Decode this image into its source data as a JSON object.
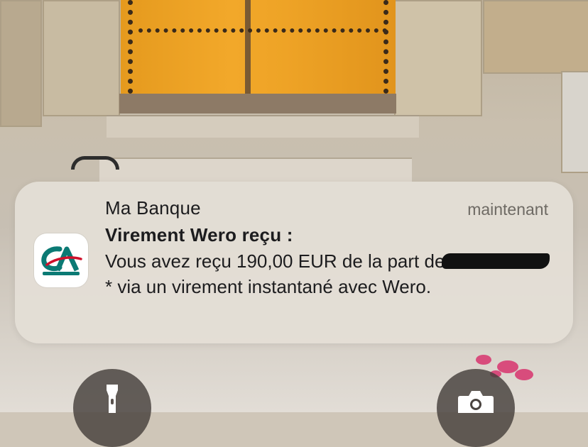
{
  "notification": {
    "app_name": "Ma Banque",
    "time": "maintenant",
    "title": "Virement Wero reçu :",
    "body_part1": "Vous avez reçu 190,00 EUR de la part de",
    "body_redacted_tail": "*",
    "body_part2": " via un virement instantané avec Wero.",
    "app_icon": "credit-agricole-logo"
  },
  "lock_screen": {
    "left_button_icon": "flashlight-icon",
    "right_button_icon": "camera-icon"
  },
  "colors": {
    "logo_teal": "#0b7a74",
    "logo_red": "#d0102b",
    "card_bg": "#e4dfd6"
  }
}
